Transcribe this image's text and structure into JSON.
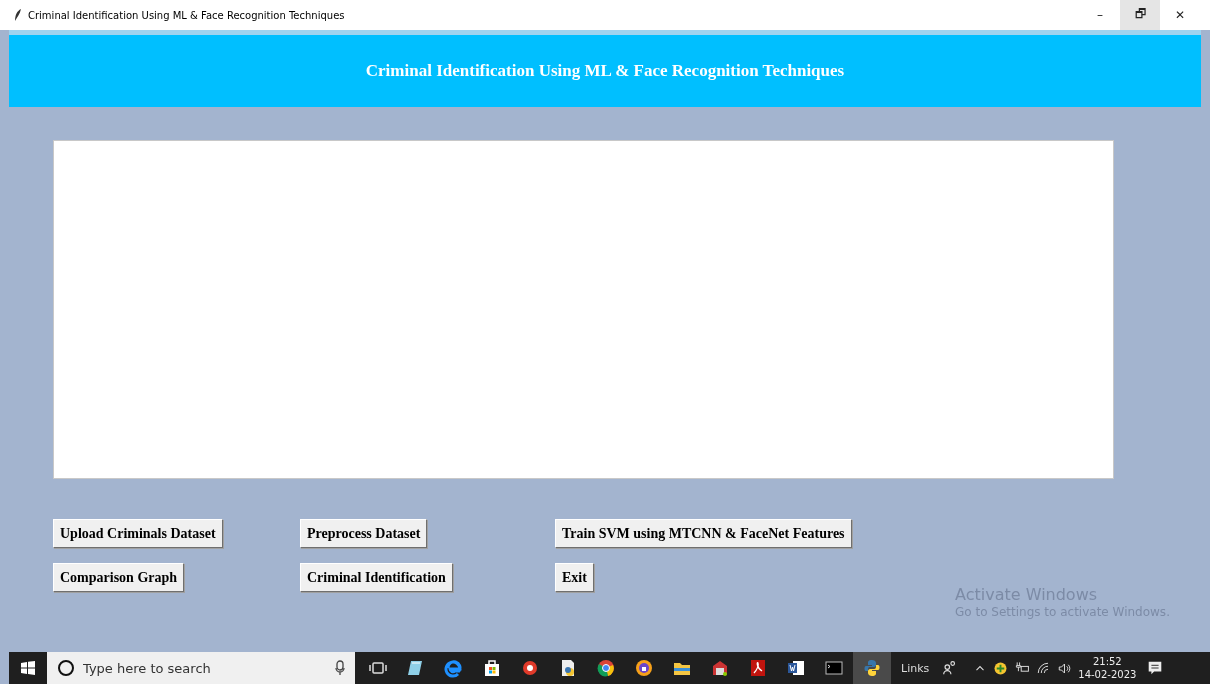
{
  "window": {
    "title": "Criminal Identification Using ML & Face Recognition Techniques",
    "controls": [
      "–",
      "🗗",
      "✕"
    ]
  },
  "header": {
    "title": "Criminal Identification Using ML & Face Recognition Techniques"
  },
  "buttons": [
    {
      "label": "Upload Criminals Dataset"
    },
    {
      "label": "Preprocess Dataset"
    },
    {
      "label": "Train SVM using MTCNN & FaceNet Features"
    },
    {
      "label": "Comparison Graph"
    },
    {
      "label": "Criminal Identification"
    },
    {
      "label": "Exit"
    }
  ],
  "os_watermark": {
    "title": "Activate Windows",
    "subtitle": "Go to Settings to activate Windows."
  },
  "taskbar": {
    "search": {
      "placeholder": "Type here to search"
    },
    "links": "Links",
    "time": "21:52",
    "date": "14-02-2023"
  }
}
